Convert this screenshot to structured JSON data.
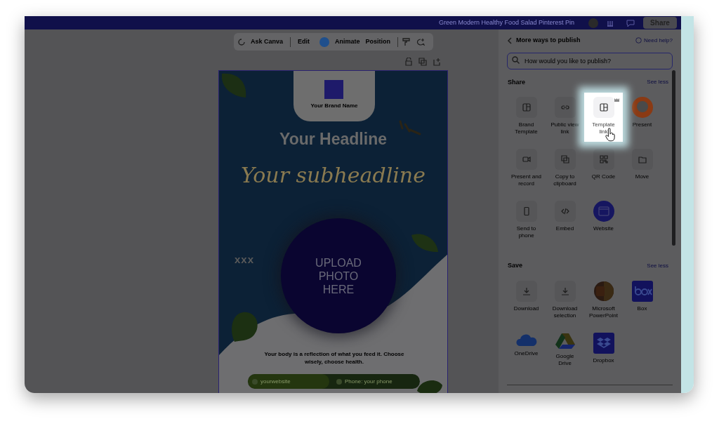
{
  "window": {
    "title": "Green Modern Healthy Food Salad Pinterest Pin"
  },
  "topbar": {
    "share_button": "Share"
  },
  "toolbar": {
    "buttons": [
      "Ask Canva",
      "Edit",
      "Animate",
      "Position"
    ]
  },
  "design": {
    "brand_name": "Your Brand Name",
    "headline": "Your Headline",
    "subheadline": "Your subheadline",
    "decoration": "xxx",
    "photo_placeholder": "UPLOAD PHOTO HERE",
    "body": "Your body is a reflection of what you feed it. Choose wisely, choose health.",
    "website": "yourwebsite",
    "phone": "Phone: your phone"
  },
  "panel": {
    "title": "More ways to publish",
    "help_link": "Need help?",
    "search": {
      "placeholder": "How would you like to publish?"
    },
    "sections": [
      {
        "title": "Share",
        "toggle": "See less",
        "items": [
          {
            "label": "Brand Template",
            "selected": false
          },
          {
            "label": "Public view link",
            "selected": false
          },
          {
            "label": "Template link",
            "selected": true
          },
          {
            "label": "Present",
            "selected": false
          },
          {
            "label": "Present and record",
            "selected": false
          },
          {
            "label": "Copy to clipboard",
            "selected": false
          },
          {
            "label": "QR Code",
            "selected": false
          },
          {
            "label": "Move",
            "selected": false
          },
          {
            "label": "Send to phone",
            "selected": false
          },
          {
            "label": "Embed",
            "selected": false
          },
          {
            "label": "Website",
            "selected": false
          }
        ]
      },
      {
        "title": "Save",
        "toggle": "See less",
        "items": [
          {
            "label": "Download",
            "selected": false
          },
          {
            "label": "Download selection",
            "selected": false
          },
          {
            "label": "Microsoft PowerPoint",
            "selected": false
          },
          {
            "label": "Box",
            "selected": false
          },
          {
            "label": "OneDrive",
            "selected": false
          },
          {
            "label": "Google Drive",
            "selected": false
          },
          {
            "label": "Dropbox",
            "selected": false
          }
        ]
      }
    ]
  }
}
